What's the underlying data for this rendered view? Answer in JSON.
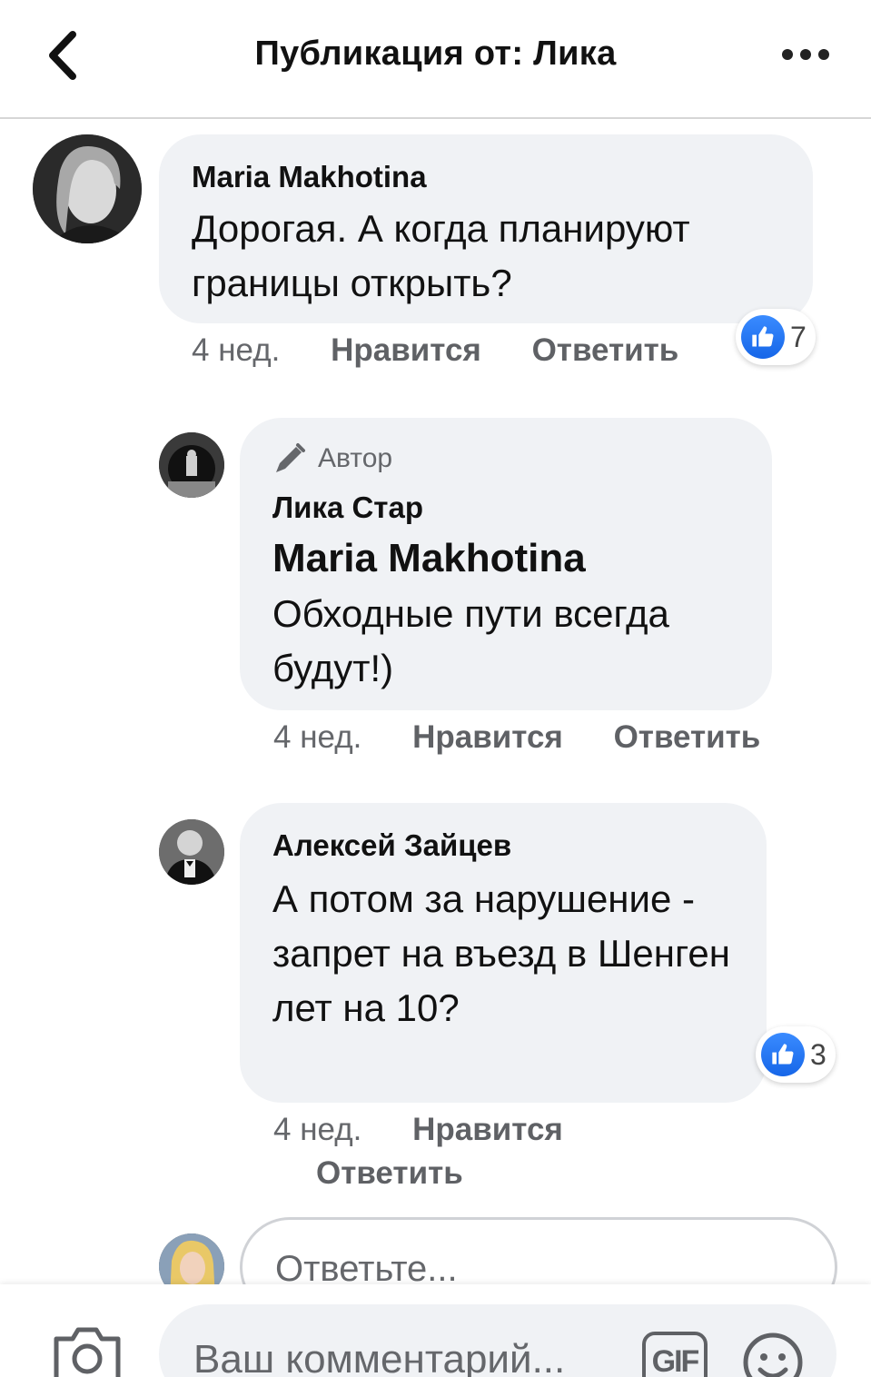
{
  "header": {
    "title": "Публикация от: Лика"
  },
  "comments": [
    {
      "author": "Maria Makhotina",
      "text": "Дорогая. А когда планируют границы открыть?",
      "time": "4 нед.",
      "like_label": "Нравится",
      "reply_label": "Ответить",
      "reactions": "7"
    },
    {
      "badge": "Автор",
      "author": "Лика Стар",
      "mention": "Maria Makhotina",
      "text": "Обходные пути всегда будут!)",
      "time": "4 нед.",
      "like_label": "Нравится",
      "reply_label": "Ответить"
    },
    {
      "author": "Алексей Зайцев",
      "text": "А потом за нарушение - запрет на въезд в Шенген лет на 10?",
      "time": "4 нед.",
      "like_label": "Нравится",
      "reply_label": "Ответить",
      "reactions": "3"
    }
  ],
  "reply_input": {
    "placeholder": "Ответьте..."
  },
  "composer": {
    "placeholder": "Ваш комментарий...",
    "gif_label": "GIF"
  },
  "colors": {
    "like_blue": "#1877f2",
    "bubble": "#f0f2f5",
    "meta_text": "#65676b"
  }
}
